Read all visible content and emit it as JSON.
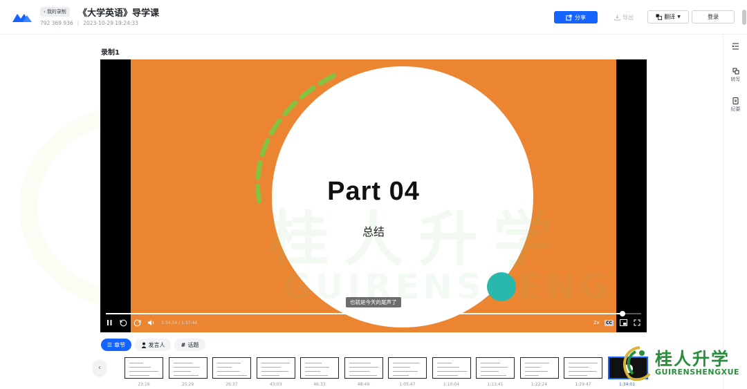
{
  "header": {
    "back_label": "我的录制",
    "title": "《大学英语》导学课",
    "meeting_id": "792 369 936",
    "datetime": "2023-10-29 19:24:33",
    "share_label": "分享",
    "export_label": "导出",
    "translate_label": "翻译",
    "login_label": "登录"
  },
  "rail": {
    "transcribe_label": "转写",
    "minutes_label": "纪要"
  },
  "recording": {
    "title": "录制1"
  },
  "slide": {
    "heading": "Part 04",
    "subheading": "总结",
    "watermark_cn": "桂人升学",
    "watermark_en": "GUIRENSHENGXUE"
  },
  "player": {
    "subtitle": "也就是今天的尾声了",
    "time": "1:34:24 / 1:37:44",
    "speed": "2x",
    "cc_label": "CC",
    "progress": 0.965
  },
  "tabs": {
    "chapters": "章节",
    "speakers": "发言人",
    "topics": "话题"
  },
  "thumbnails": [
    {
      "time": "23:16"
    },
    {
      "time": "25:29"
    },
    {
      "time": "26:37"
    },
    {
      "time": "43:03"
    },
    {
      "time": "46:33"
    },
    {
      "time": "48:49"
    },
    {
      "time": "1:05:47"
    },
    {
      "time": "1:10:04"
    },
    {
      "time": "1:13:41"
    },
    {
      "time": "1:22:24"
    },
    {
      "time": "1:29:47"
    },
    {
      "time": "1:34:01"
    }
  ],
  "brand": {
    "name_cn": "桂人升学",
    "name_en": "GUIRENSHENGXUE"
  },
  "colors": {
    "accent": "#1664ff",
    "slide_orange": "#ec8532",
    "teal": "#2ab8ac",
    "green_dash": "#88c141",
    "brand_green": "#2a8f3c"
  }
}
